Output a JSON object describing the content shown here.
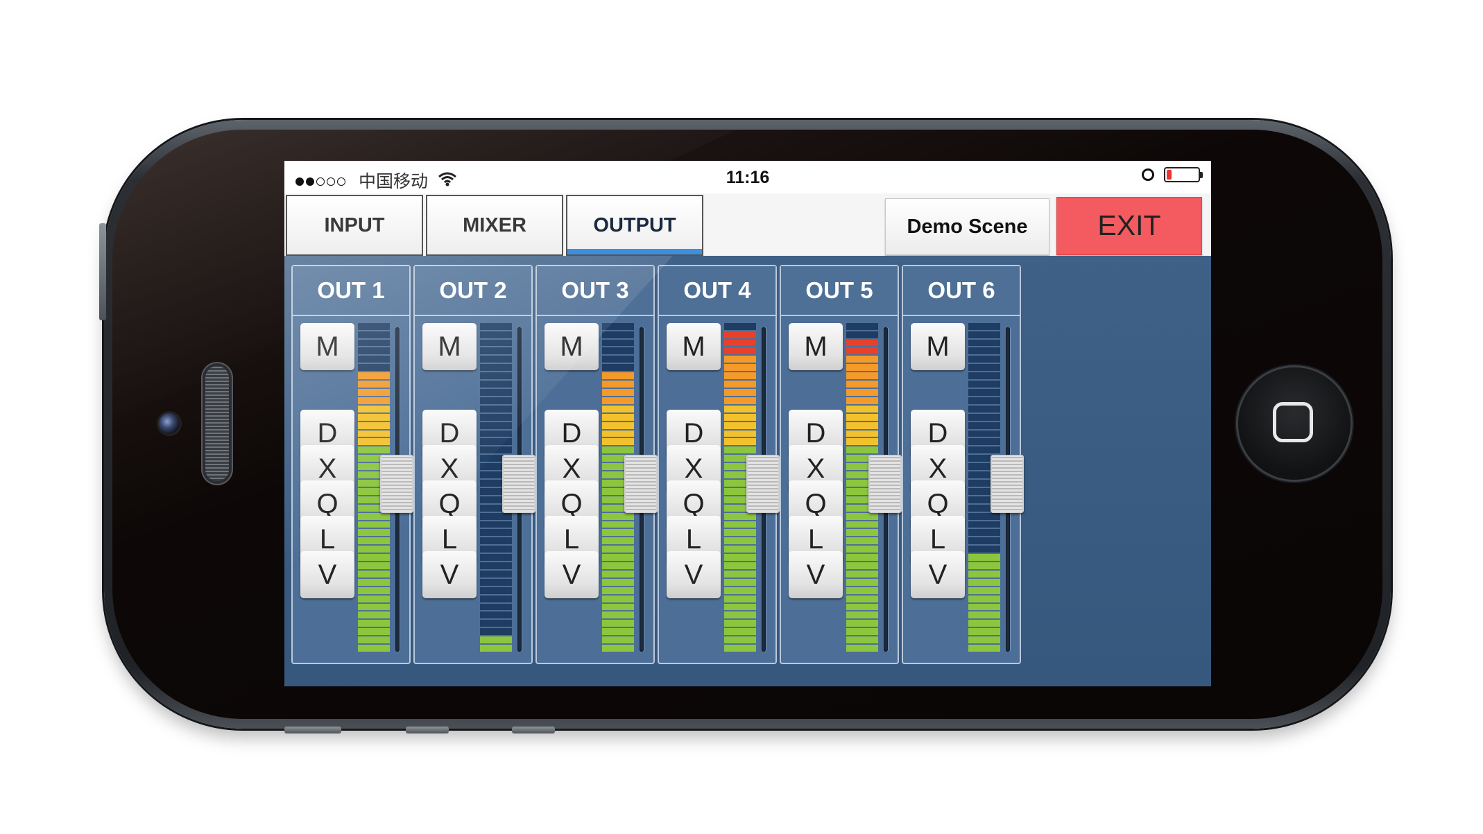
{
  "status_bar": {
    "signal_dots": [
      true,
      true,
      false,
      false,
      false
    ],
    "carrier": "中国移动",
    "wifi_icon": "wifi-icon",
    "time": "11:16",
    "alarm_icon": "alarm-clock-icon",
    "battery_level": 0.15
  },
  "tabs": [
    {
      "label": "INPUT",
      "active": false
    },
    {
      "label": "MIXER",
      "active": false
    },
    {
      "label": "OUTPUT",
      "active": true
    }
  ],
  "scene": {
    "label": "Demo Scene"
  },
  "exit": {
    "label": "EXIT",
    "color": "#f35b61"
  },
  "meter_colors": {
    "off": "#1f3c62",
    "green": "#8cc63f",
    "yellow": "#f2c12e",
    "orange": "#f39a2a",
    "red": "#e8402a"
  },
  "channels": [
    {
      "name": "OUT 1",
      "buttons": [
        "M",
        "D",
        "X",
        "Q",
        "L",
        "V"
      ],
      "meter_level": 0.85,
      "fader_level": 0.52
    },
    {
      "name": "OUT 2",
      "buttons": [
        "M",
        "D",
        "X",
        "Q",
        "L",
        "V"
      ],
      "meter_level": 0.06,
      "fader_level": 0.52
    },
    {
      "name": "OUT 3",
      "buttons": [
        "M",
        "D",
        "X",
        "Q",
        "L",
        "V"
      ],
      "meter_level": 0.86,
      "fader_level": 0.52
    },
    {
      "name": "OUT 4",
      "buttons": [
        "M",
        "D",
        "X",
        "Q",
        "L",
        "V"
      ],
      "meter_level": 0.98,
      "fader_level": 0.52
    },
    {
      "name": "OUT 5",
      "buttons": [
        "M",
        "D",
        "X",
        "Q",
        "L",
        "V"
      ],
      "meter_level": 0.96,
      "fader_level": 0.52
    },
    {
      "name": "OUT 6",
      "buttons": [
        "M",
        "D",
        "X",
        "Q",
        "L",
        "V"
      ],
      "meter_level": 0.3,
      "fader_level": 0.52
    }
  ]
}
